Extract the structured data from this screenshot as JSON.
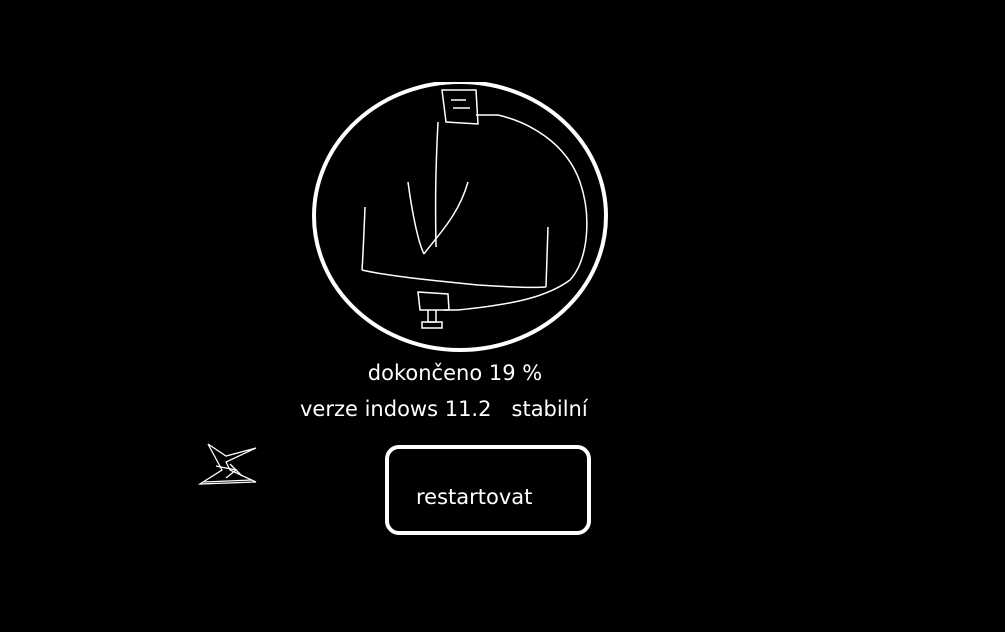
{
  "progress": {
    "percent": 19,
    "label": "dokončeno 19 %"
  },
  "version": {
    "name": "verze indows 11.2",
    "channel": "stabilní"
  },
  "actions": {
    "restart_label": "restartovat"
  },
  "icons": {
    "illustration": "update-clock-icon",
    "logo": "windows-scribble-logo-icon"
  },
  "colors": {
    "background": "#000000",
    "foreground": "#ffffff"
  }
}
